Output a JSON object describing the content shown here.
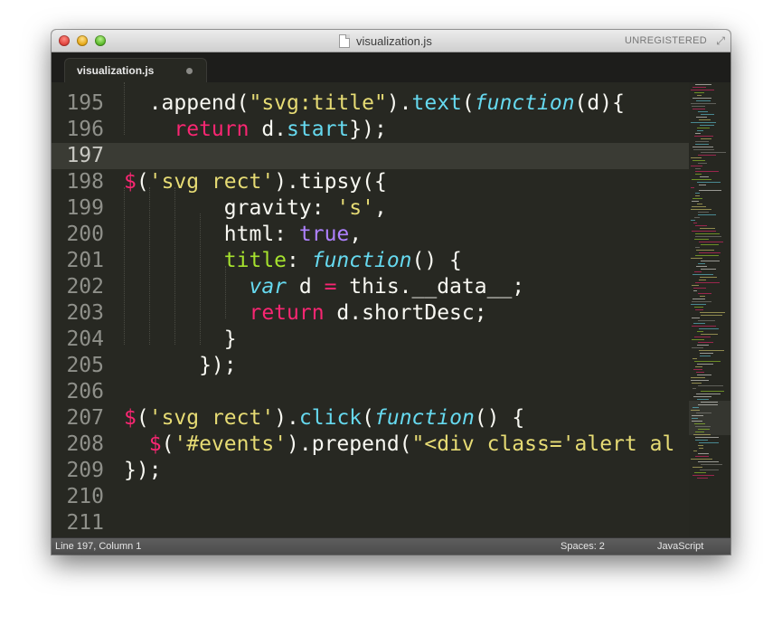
{
  "window": {
    "title": "visualization.js",
    "registration": "UNREGISTERED"
  },
  "tab": {
    "label": "visualization.js"
  },
  "editor": {
    "line_numbers": [
      "195",
      "196",
      "197",
      "198",
      "199",
      "200",
      "201",
      "202",
      "203",
      "204",
      "205",
      "206",
      "207",
      "208",
      "209",
      "210",
      "211"
    ],
    "highlighted_line": "197",
    "colors": {
      "background": "#272822",
      "keyword": "#f92672",
      "string": "#e6db74",
      "function": "#66d9ef",
      "constant": "#ae81ff",
      "property": "#a6e22e",
      "text": "#f8f8f2"
    },
    "code_lines": [
      [
        {
          "t": "  .append("
        },
        {
          "t": "\"svg:title\"",
          "c": "st"
        },
        {
          "t": ")."
        },
        {
          "t": "text",
          "c": "fn"
        },
        {
          "t": "("
        },
        {
          "t": "function",
          "c": "it"
        },
        {
          "t": "(d){"
        }
      ],
      [
        {
          "t": "    "
        },
        {
          "t": "return",
          "c": "kw"
        },
        {
          "t": " d."
        },
        {
          "t": "start",
          "c": "fn"
        },
        {
          "t": "});"
        }
      ],
      [],
      [
        {
          "t": "$",
          "c": "kw"
        },
        {
          "t": "("
        },
        {
          "t": "'svg rect'",
          "c": "st"
        },
        {
          "t": ").tipsy({"
        }
      ],
      [
        {
          "t": "        gravity: "
        },
        {
          "t": "'s'",
          "c": "st"
        },
        {
          "t": ","
        }
      ],
      [
        {
          "t": "        html: "
        },
        {
          "t": "true",
          "c": "cn"
        },
        {
          "t": ","
        }
      ],
      [
        {
          "t": "        "
        },
        {
          "t": "title",
          "c": "gr"
        },
        {
          "t": ": "
        },
        {
          "t": "function",
          "c": "it"
        },
        {
          "t": "() {"
        }
      ],
      [
        {
          "t": "          "
        },
        {
          "t": "var",
          "c": "it"
        },
        {
          "t": " d "
        },
        {
          "t": "=",
          "c": "kw"
        },
        {
          "t": " this.__data__;"
        }
      ],
      [
        {
          "t": "          "
        },
        {
          "t": "return",
          "c": "kw"
        },
        {
          "t": " d.shortDesc;"
        }
      ],
      [
        {
          "t": "        }"
        }
      ],
      [
        {
          "t": "      });"
        }
      ],
      [],
      [
        {
          "t": "$",
          "c": "kw"
        },
        {
          "t": "("
        },
        {
          "t": "'svg rect'",
          "c": "st"
        },
        {
          "t": ")."
        },
        {
          "t": "click",
          "c": "fn"
        },
        {
          "t": "("
        },
        {
          "t": "function",
          "c": "it"
        },
        {
          "t": "() {"
        }
      ],
      [
        {
          "t": "  "
        },
        {
          "t": "$",
          "c": "kw"
        },
        {
          "t": "("
        },
        {
          "t": "'#events'",
          "c": "st"
        },
        {
          "t": ").prepend("
        },
        {
          "t": "\"<div class='alert al",
          "c": "st"
        }
      ],
      [
        {
          "t": "});"
        }
      ],
      [],
      []
    ]
  },
  "status": {
    "position": "Line 197, Column 1",
    "indent": "Spaces: 2",
    "syntax": "JavaScript"
  }
}
